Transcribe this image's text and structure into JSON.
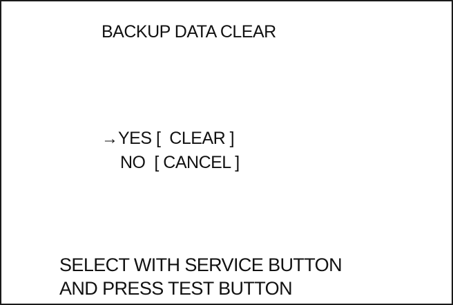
{
  "screen": {
    "title": "BACKUP DATA CLEAR",
    "cursor_glyph": "→",
    "options": [
      {
        "label": "YES [  CLEAR ]",
        "selected": true
      },
      {
        "label": "NO  [ CANCEL ]",
        "selected": false
      }
    ],
    "instructions": [
      "SELECT WITH SERVICE BUTTON",
      "AND PRESS TEST BUTTON"
    ]
  },
  "colors": {
    "background": "#ffffff",
    "text": "#111111",
    "border": "#1a1a1a"
  }
}
